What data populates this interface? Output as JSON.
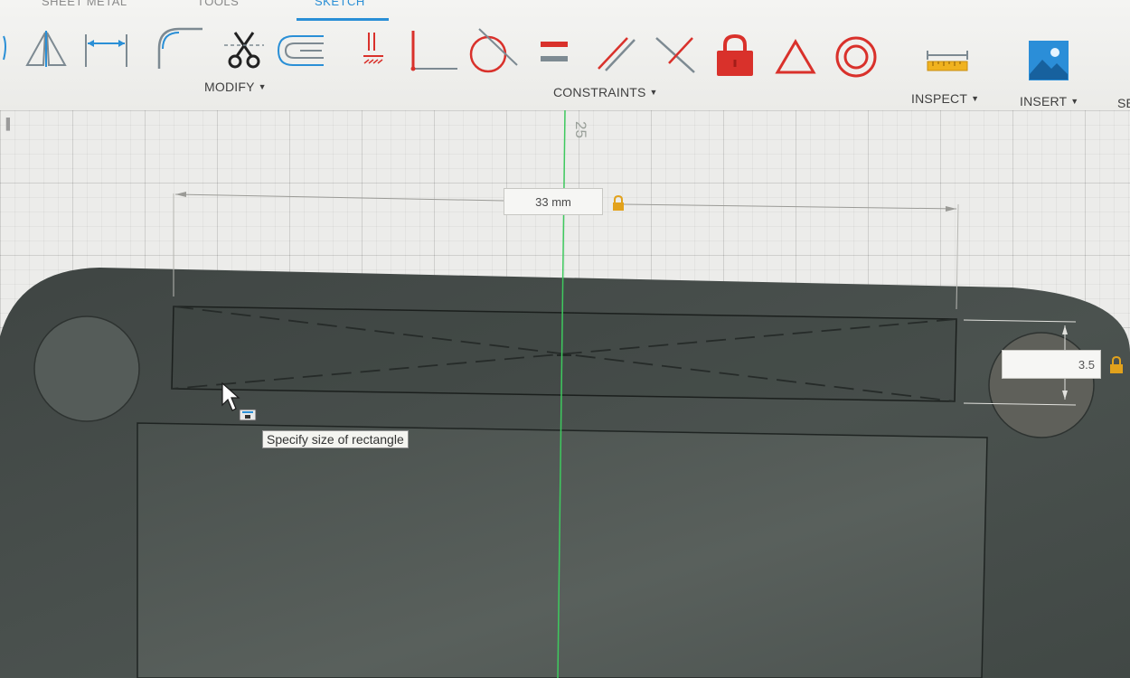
{
  "tabs": {
    "sheet_metal": "SHEET METAL",
    "tools": "TOOLS",
    "sketch": "SKETCH",
    "active": "SKETCH"
  },
  "groups": {
    "modify": "MODIFY",
    "constraints": "CONSTRAINTS",
    "inspect": "INSPECT",
    "insert": "INSERT",
    "select_partial": "SE"
  },
  "tool_icons": {
    "mirror": "mirror-icon",
    "dimension": "dimension-icon",
    "fillet": "fillet-icon",
    "trim": "scissors-icon",
    "offset": "offset-icon",
    "tangent_modify": "sketch-scale-icon",
    "coincident": "coincident-icon",
    "tangent": "tangent-icon",
    "equal": "equal-icon",
    "parallel": "parallel-icon",
    "perpendicular": "perpendicular-icon",
    "fix": "lock-icon",
    "symmetric": "triangle-icon",
    "concentric": "concentric-icon",
    "measure": "measure-icon",
    "insert_image": "insert-image-icon"
  },
  "dimensions": {
    "width_value": "33 mm",
    "height_value": "3.5",
    "axis_value": "25"
  },
  "tooltip": "Specify size of rectangle",
  "colors": {
    "accent_blue": "#2a8fd6",
    "constraint_red": "#d9312b",
    "lock_gold": "#e2a21c",
    "board": "#444b48",
    "axis_green": "#3ec95e"
  }
}
